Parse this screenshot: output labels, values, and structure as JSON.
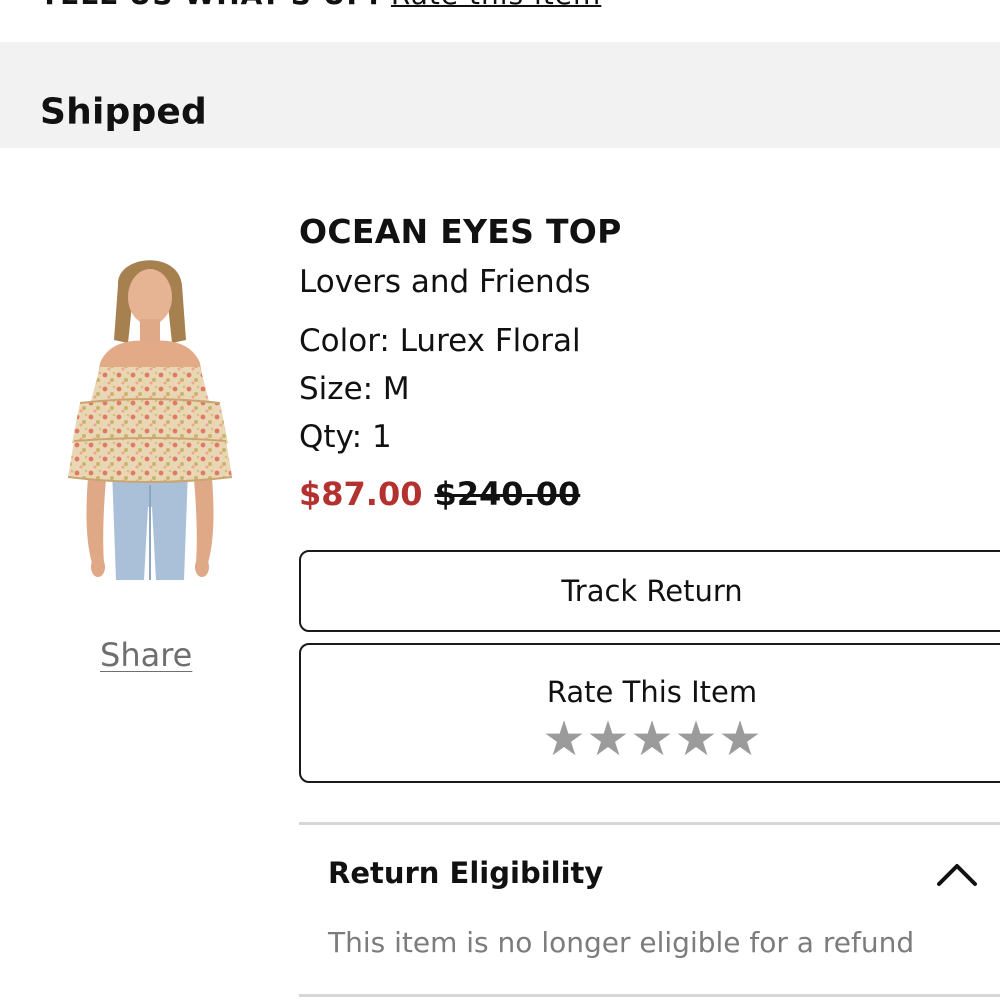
{
  "top_banner": {
    "prefix_text": "TELL US WHAT'S UP:",
    "link_text": "Rate this item"
  },
  "order_status": {
    "title": "Shipped"
  },
  "product": {
    "name": "OCEAN EYES TOP",
    "brand": "Lovers and Friends",
    "color": "Color: Lurex Floral",
    "size": "Size: M",
    "qty": "Qty: 1",
    "sale_price": "$87.00",
    "original_price": "$240.00",
    "image_alt": "Ocean Eyes Top product photo",
    "share_label": "Share"
  },
  "actions": {
    "track_return_label": "Track Return",
    "rate_label": "Rate This Item",
    "rating": {
      "value": 0,
      "max": 5
    }
  },
  "return_eligibility": {
    "title": "Return Eligibility",
    "message": "This item is no longer eligible for a refund",
    "expanded": true
  },
  "colors": {
    "sale_price": "#b3322f",
    "status_bar_bg": "#f2f2f2",
    "star_empty": "#9b9b9b",
    "muted_text": "#7c7c7c"
  },
  "icons": [
    "star-icon",
    "chevron-up-icon"
  ]
}
